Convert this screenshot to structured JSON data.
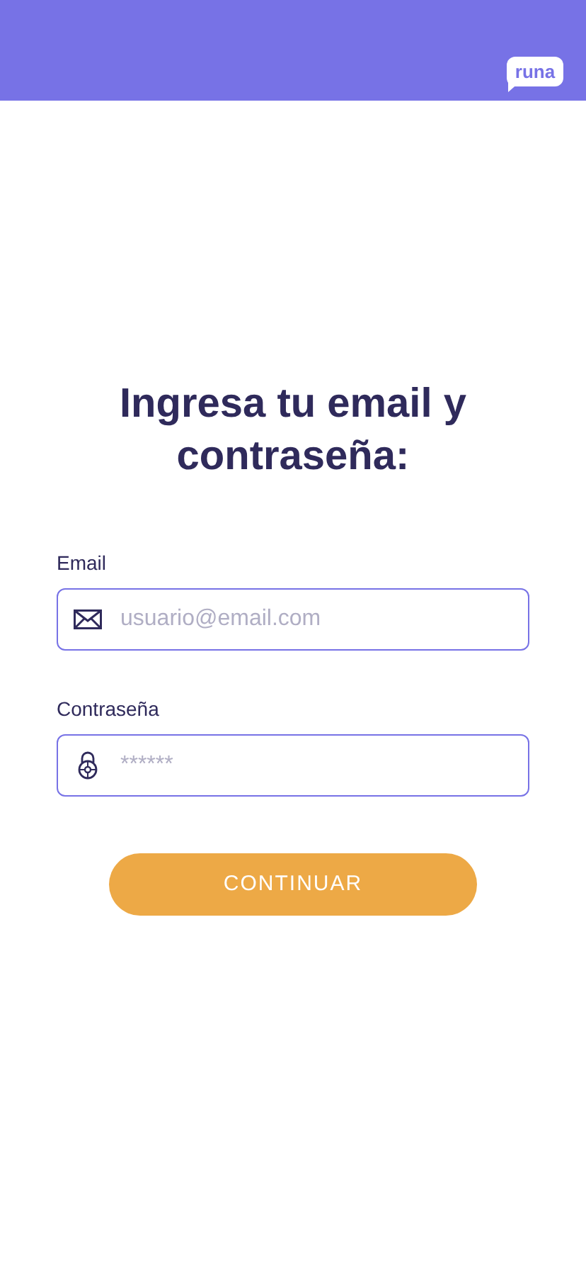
{
  "header": {
    "logo": "runa"
  },
  "title": "Ingresa tu email y contraseña:",
  "fields": [
    {
      "kind": "email",
      "label": "Email",
      "placeholder": "usuario@email.com"
    },
    {
      "kind": "password",
      "label": "Contraseña",
      "placeholder": "******"
    }
  ],
  "button": "CONTINUAR"
}
